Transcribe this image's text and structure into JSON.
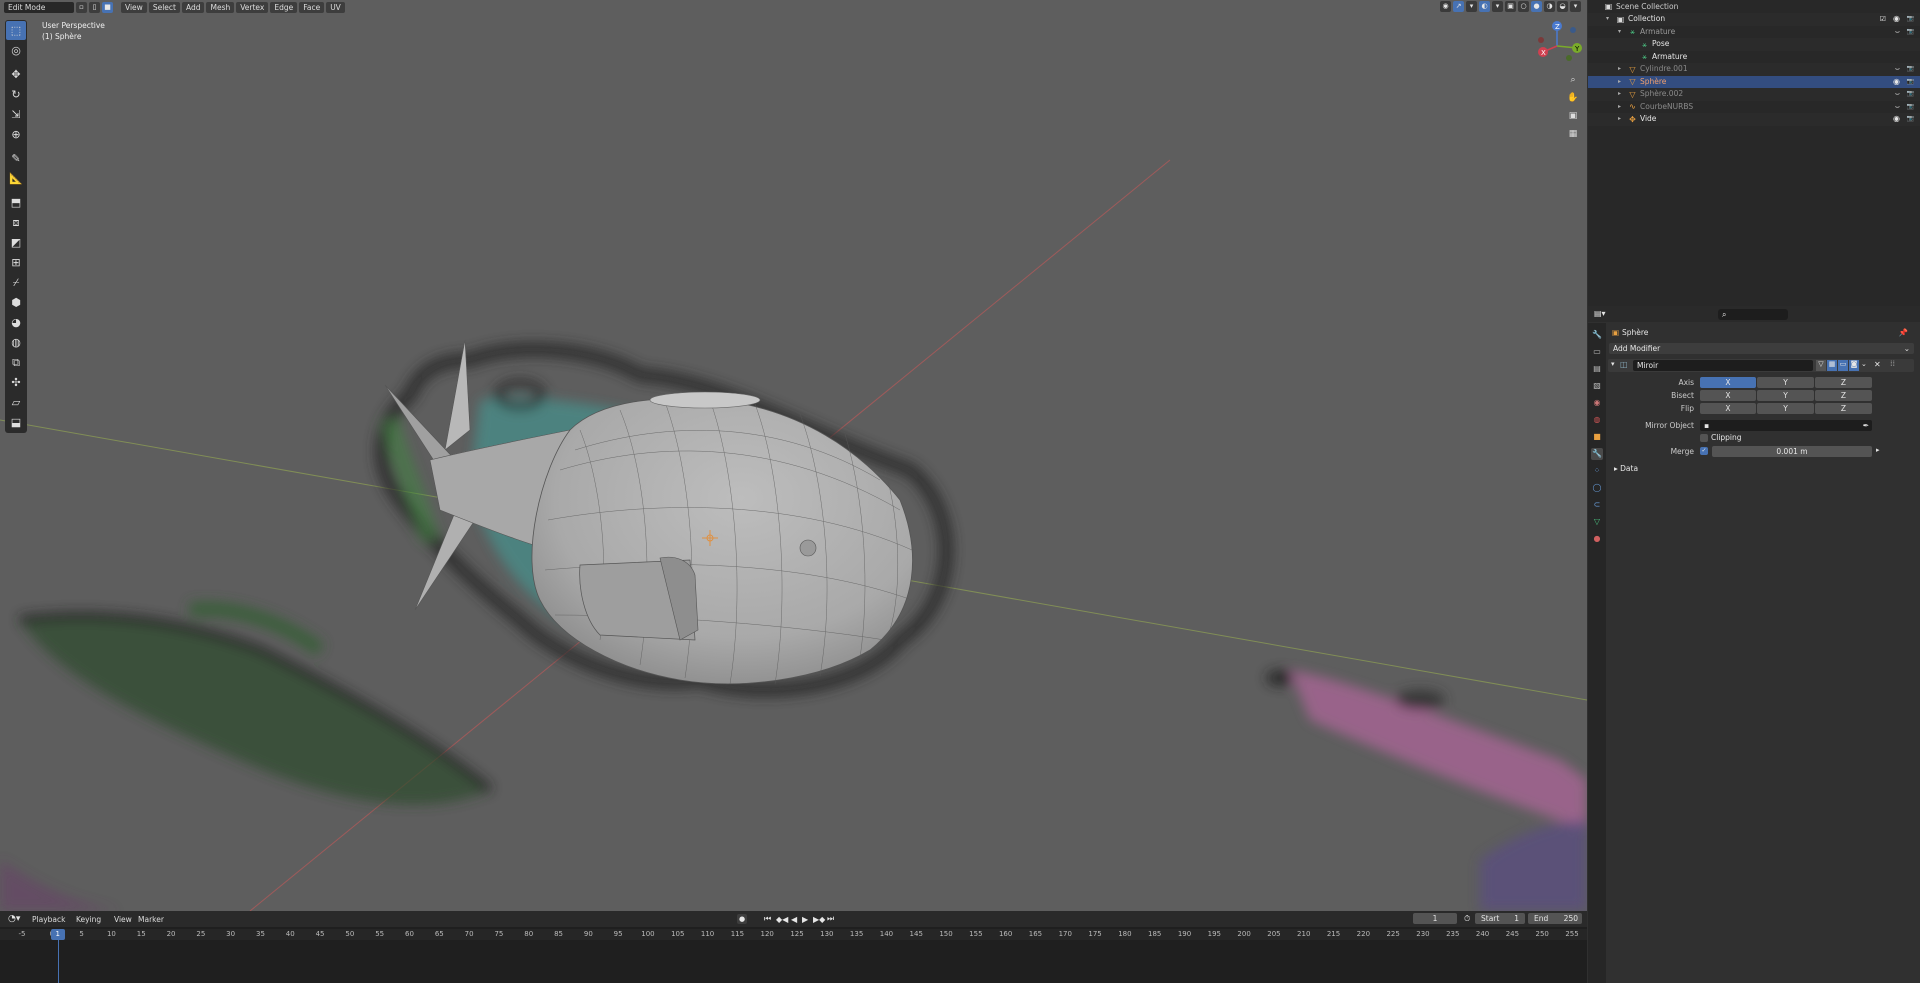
{
  "header": {
    "mode": "Edit Mode",
    "menus": [
      "View",
      "Select",
      "Add",
      "Mesh",
      "Vertex",
      "Edge",
      "Face",
      "UV"
    ]
  },
  "viewport": {
    "perspective": "User Perspective",
    "object": "(1) Sphère"
  },
  "toolbar": {
    "icons": [
      "select-box-icon",
      "cursor-icon",
      "move-icon",
      "rotate-icon",
      "scale-icon",
      "transform-icon",
      "annotate-icon",
      "measure-icon",
      "extrude-icon",
      "inset-icon",
      "bevel-icon",
      "loop-cut-icon",
      "knife-icon",
      "poly-build-icon",
      "spin-icon",
      "smooth-icon",
      "edge-slide-icon",
      "shrink-icon",
      "shear-icon",
      "rip-icon"
    ]
  },
  "outliner": {
    "rows": [
      {
        "label": "Scene Collection",
        "indent": 0,
        "icon": "collection-icon",
        "color": "#cccccc",
        "dim": false
      },
      {
        "label": "Collection",
        "indent": 1,
        "icon": "collection-icon",
        "color": "#e6e6e6",
        "dim": false
      },
      {
        "label": "Armature",
        "indent": 2,
        "icon": "armature-icon",
        "color": "#999999",
        "dim": true
      },
      {
        "label": "Pose",
        "indent": 3,
        "icon": "pose-icon",
        "color": "#e6e6e6",
        "dim": false
      },
      {
        "label": "Armature",
        "indent": 3,
        "icon": "armature-icon",
        "color": "#e6e6e6",
        "dim": false
      },
      {
        "label": "Cylindre.001",
        "indent": 2,
        "icon": "mesh-icon",
        "color": "#8a8a8a",
        "dim": true
      },
      {
        "label": "Sphère",
        "indent": 2,
        "icon": "mesh-icon",
        "color": "#f0a070",
        "dim": false
      },
      {
        "label": "Sphère.002",
        "indent": 2,
        "icon": "mesh-icon",
        "color": "#8a8a8a",
        "dim": true
      },
      {
        "label": "CourbeNURBS",
        "indent": 2,
        "icon": "curve-icon",
        "color": "#8a8a8a",
        "dim": true
      },
      {
        "label": "Vide",
        "indent": 2,
        "icon": "empty-icon",
        "color": "#e6e6e6",
        "dim": false
      }
    ]
  },
  "properties": {
    "object_name": "Sphère",
    "add_modifier": "Add Modifier",
    "modifier_name": "Miroir",
    "axis_label": "Axis",
    "bisect_label": "Bisect",
    "flip_label": "Flip",
    "x": "X",
    "y": "Y",
    "z": "Z",
    "mirror_object_label": "Mirror Object",
    "clipping_label": "Clipping",
    "merge_label": "Merge",
    "merge_value": "0.001 m",
    "data_label": "Data"
  },
  "timeline": {
    "menus": [
      "Playback",
      "Keying",
      "View",
      "Marker"
    ],
    "current_frame": "1",
    "start_label": "Start",
    "start_value": "1",
    "end_label": "End",
    "end_value": "250",
    "ticks": [
      "-5",
      "0",
      "5",
      "10",
      "15",
      "20",
      "25",
      "30",
      "35",
      "40",
      "45",
      "50",
      "55",
      "60",
      "65",
      "70",
      "75",
      "80",
      "85",
      "90",
      "95",
      "100",
      "105",
      "110",
      "115",
      "120",
      "125",
      "130",
      "135",
      "140",
      "145",
      "150",
      "155",
      "160",
      "165",
      "170",
      "175",
      "180",
      "185",
      "190",
      "195",
      "200",
      "205",
      "210",
      "215",
      "220",
      "225",
      "230",
      "235",
      "240",
      "245",
      "250",
      "255"
    ],
    "cursor_label": "1"
  },
  "colors": {
    "accent": "#4772b3",
    "viewport_bg": "#5e5e5e",
    "panel_bg": "#303030"
  }
}
